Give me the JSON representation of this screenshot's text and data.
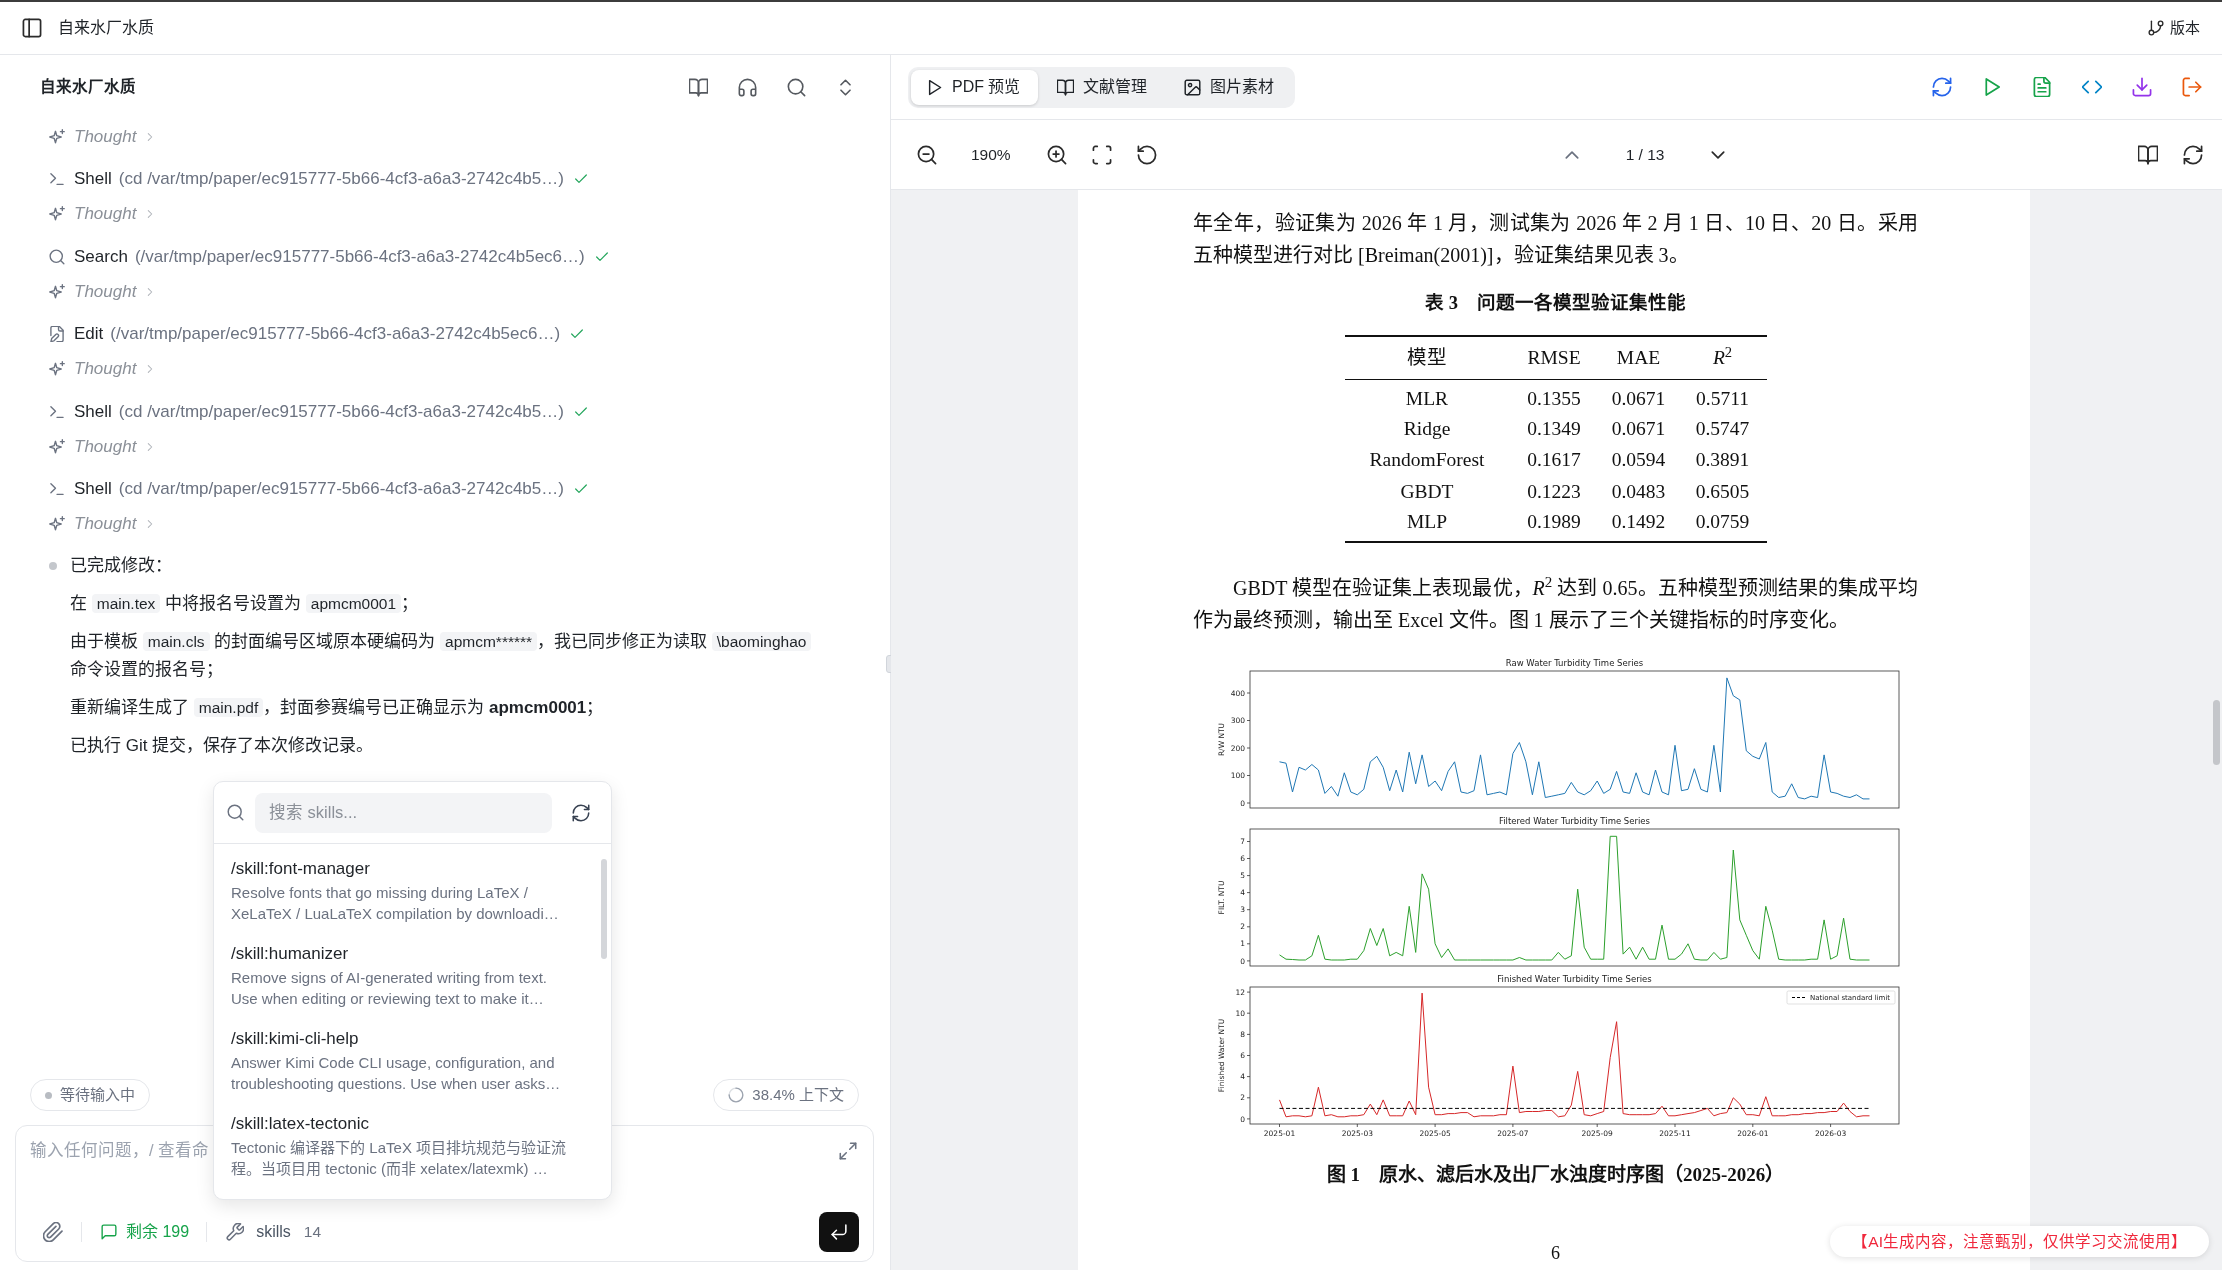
{
  "top_bar": {
    "title": "自来水厂水质",
    "version_label": "版本"
  },
  "chat": {
    "title": "自来水厂水质",
    "steps": [
      {
        "kind": "thought",
        "label": "Thought",
        "expanded": false
      },
      {
        "kind": "shell",
        "label": "Shell",
        "detail": "(cd /var/tmp/paper/ec915777-5b66-4cf3-a6a3-2742c4b5…)",
        "done": true
      },
      {
        "kind": "thought",
        "label": "Thought",
        "expanded": false
      },
      {
        "kind": "search",
        "label": "Search",
        "detail": "(/var/tmp/paper/ec915777-5b66-4cf3-a6a3-2742c4b5ec6…)",
        "done": true
      },
      {
        "kind": "thought",
        "label": "Thought",
        "expanded": false
      },
      {
        "kind": "edit",
        "label": "Edit",
        "detail": "(/var/tmp/paper/ec915777-5b66-4cf3-a6a3-2742c4b5ec6…)",
        "done": true
      },
      {
        "kind": "thought",
        "label": "Thought",
        "expanded": false
      },
      {
        "kind": "shell",
        "label": "Shell",
        "detail": "(cd /var/tmp/paper/ec915777-5b66-4cf3-a6a3-2742c4b5…)",
        "done": true
      },
      {
        "kind": "thought",
        "label": "Thought",
        "expanded": false
      },
      {
        "kind": "shell",
        "label": "Shell",
        "detail": "(cd /var/tmp/paper/ec915777-5b66-4cf3-a6a3-2742c4b5…)",
        "done": true
      },
      {
        "kind": "thought",
        "label": "Thought",
        "expanded": false
      }
    ],
    "summary": {
      "heading": "已完成修改：",
      "lines": [
        [
          {
            "kind": "text",
            "text": "在 "
          },
          {
            "kind": "code",
            "text": "main.tex"
          },
          {
            "kind": "text",
            "text": " 中将报名号设置为 "
          },
          {
            "kind": "code",
            "text": "apmcm0001"
          },
          {
            "kind": "text",
            "text": "；"
          }
        ],
        [
          {
            "kind": "text",
            "text": "由于模板 "
          },
          {
            "kind": "code",
            "text": "main.cls"
          },
          {
            "kind": "text",
            "text": " 的封面编号区域原本硬编码为 "
          },
          {
            "kind": "code",
            "text": "apmcm******"
          },
          {
            "kind": "text",
            "text": "，我已同步修正为读取 "
          },
          {
            "kind": "code",
            "text": "\\baominghao"
          },
          {
            "kind": "text",
            "text": " 命令设置的报名号；"
          }
        ],
        [
          {
            "kind": "text",
            "text": "重新编译生成了 "
          },
          {
            "kind": "code",
            "text": "main.pdf"
          },
          {
            "kind": "text",
            "text": "，封面参赛编号已正确显示为 **apmcm0001**；"
          }
        ],
        [
          {
            "kind": "text",
            "text": "已执行 Git 提交，保存了本次修改记录。"
          }
        ]
      ]
    },
    "status": "等待输入中",
    "context_usage": "38.4% 上下文",
    "composer": {
      "placeholder": "输入任何问题，/ 查看命",
      "remaining": "剩余 199",
      "skills_label": "skills",
      "skills_count": "14"
    },
    "skills_menu": {
      "search_placeholder": "搜索 skills...",
      "items": [
        {
          "name": "/skill:font-manager",
          "description": "Resolve fonts that go missing during LaTeX / XeLaTeX / LuaLaTeX compilation by downloadi…"
        },
        {
          "name": "/skill:humanizer",
          "description": "Remove signs of AI-generated writing from text. Use when editing or reviewing text to make it…"
        },
        {
          "name": "/skill:kimi-cli-help",
          "description": "Answer Kimi Code CLI usage, configuration, and troubleshooting questions. Use when user asks…"
        },
        {
          "name": "/skill:latex-tectonic",
          "description": "Tectonic 编译器下的 LaTeX 项目排坑规范与验证流程。当项目用 tectonic (而非 xelatex/latexmk) …"
        }
      ]
    }
  },
  "preview": {
    "tabs": [
      {
        "label": "PDF 预览",
        "selected": true
      },
      {
        "label": "文献管理",
        "selected": false
      },
      {
        "label": "图片素材",
        "selected": false
      }
    ],
    "zoom": "190%",
    "page_indicator": "1 / 13",
    "document": {
      "intro": "年全年，验证集为 2026 年 1 月，测试集为 2026 年 2 月 1 日、10 日、20 日。采用五种模型进行对比 [Breiman(2001)]，验证集结果见表 3。",
      "table": {
        "caption": "表 3　问题一各模型验证集性能",
        "columns": [
          "模型",
          "RMSE",
          "MAE",
          "*R*$^{2}$"
        ],
        "rows": [
          [
            "MLR",
            "0.1355",
            "0.0671",
            "0.5711"
          ],
          [
            "Ridge",
            "0.1349",
            "0.0671",
            "0.5747"
          ],
          [
            "RandomForest",
            "0.1617",
            "0.0594",
            "0.3891"
          ],
          [
            "GBDT",
            "0.1223",
            "0.0483",
            "0.6505"
          ],
          [
            "MLP",
            "0.1989",
            "0.1492",
            "0.0759"
          ]
        ]
      },
      "paragraph": "GBDT 模型在验证集上表现最优，*R*$^{2}$ 达到 0.65。五种模型预测结果的集成平均作为最终预测，输出至 Excel 文件。图 1 展示了三个关键指标的时序变化。",
      "figure": {
        "panels": [
          {
            "chart_data": {
              "type": "line",
              "title": "Raw Water Turbidity Time Series",
              "ylabel": "R/W NTU",
              "categories": [
                null,
                null,
                null,
                null,
                null,
                null,
                null,
                null,
                null,
                null,
                null,
                null,
                null,
                null,
                null,
                null,
                null,
                null,
                null,
                null,
                null,
                null,
                null,
                null,
                null,
                null,
                null,
                null,
                null,
                null,
                null,
                null,
                null,
                null,
                null,
                null,
                null,
                null,
                null,
                null,
                null,
                null,
                null,
                null,
                null,
                null,
                null,
                null,
                null,
                null,
                null,
                null,
                null,
                null,
                null,
                null,
                null,
                null,
                null,
                null,
                null,
                null,
                null,
                null,
                null,
                null,
                null,
                null,
                null,
                null,
                null,
                null,
                null,
                null,
                null,
                null,
                null,
                null,
                null,
                null,
                null,
                null,
                null,
                null,
                null,
                null,
                null,
                null,
                null,
                null,
                null,
                null
              ],
              "series": [
                {
                  "color": "#1f77b4",
                  "values": [
                    150,
                    145,
                    40,
                    130,
                    120,
                    140,
                    120,
                    35,
                    60,
                    25,
                    110,
                    40,
                    30,
                    50,
                    150,
                    170,
                    130,
                    45,
                    120,
                    40,
                    185,
                    70,
                    175,
                    60,
                    80,
                    45,
                    115,
                    150,
                    40,
                    35,
                    45,
                    175,
                    30,
                    35,
                    40,
                    30,
                    180,
                    220,
                    150,
                    30,
                    150,
                    20,
                    25,
                    30,
                    35,
                    75,
                    40,
                    30,
                    45,
                    80,
                    35,
                    50,
                    115,
                    40,
                    35,
                    110,
                    40,
                    30,
                    120,
                    40,
                    30,
                    210,
                    45,
                    50,
                    125,
                    50,
                    40,
                    210,
                    40,
                    455,
                    390,
                    375,
                    190,
                    170,
                    160,
                    220,
                    40,
                    20,
                    25,
                    70,
                    20,
                    15,
                    25,
                    20,
                    175,
                    40,
                    35,
                    25,
                    20,
                    30,
                    15,
                    15
                  ]
                }
              ],
              "ylim": [
                -18,
                480
              ],
              "yticks": [
                0,
                100,
                200,
                300,
                400
              ]
            }
          },
          {
            "chart_data": {
              "type": "line",
              "title": "Filtered Water Turbidity Time Series",
              "ylabel": "FILT. NTU",
              "categories": [
                null,
                null,
                null,
                null,
                null,
                null,
                null,
                null,
                null,
                null,
                null,
                null,
                null,
                null,
                null,
                null,
                null,
                null,
                null,
                null,
                null,
                null,
                null,
                null,
                null,
                null,
                null,
                null,
                null,
                null,
                null,
                null,
                null,
                null,
                null,
                null,
                null,
                null,
                null,
                null,
                null,
                null,
                null,
                null,
                null,
                null,
                null,
                null,
                null,
                null,
                null,
                null,
                null,
                null,
                null,
                null,
                null,
                null,
                null,
                null,
                null,
                null,
                null,
                null,
                null,
                null,
                null,
                null,
                null,
                null,
                null,
                null,
                null,
                null,
                null,
                null,
                null,
                null,
                null,
                null,
                null,
                null,
                null,
                null,
                null,
                null,
                null,
                null,
                null,
                null,
                null,
                null
              ],
              "series": [
                {
                  "color": "#2ca02c",
                  "values": [
                    0.35,
                    0.1,
                    0.08,
                    0.05,
                    0.05,
                    0.3,
                    1.5,
                    0.1,
                    0.05,
                    0.05,
                    0.05,
                    0.1,
                    0.1,
                    0.6,
                    1.9,
                    0.9,
                    1.9,
                    0.3,
                    0.5,
                    0.3,
                    3.2,
                    0.5,
                    5.1,
                    4.2,
                    1.0,
                    0.2,
                    0.7,
                    0.05,
                    0.05,
                    0.05,
                    0.05,
                    0.05,
                    0.05,
                    0.05,
                    0.05,
                    0.05,
                    0.05,
                    0.2,
                    0.05,
                    0.05,
                    0.05,
                    0.05,
                    0.05,
                    0.5,
                    0.1,
                    0.3,
                    4.2,
                    0.8,
                    0.1,
                    0.1,
                    0.1,
                    7.3,
                    7.3,
                    0.4,
                    0.8,
                    0.1,
                    0.8,
                    0.1,
                    0.1,
                    2.1,
                    0.1,
                    0.1,
                    0.4,
                    1.0,
                    0.1,
                    0.05,
                    0.05,
                    0.5,
                    0.1,
                    0.2,
                    6.5,
                    2.4,
                    1.5,
                    0.6,
                    0.1,
                    3.2,
                    1.8,
                    0.1,
                    0.05,
                    0.05,
                    0.05,
                    0.05,
                    0.1,
                    0.1,
                    2.4,
                    0.1,
                    0.3,
                    2.5,
                    0.1,
                    0.05,
                    0.05,
                    0.05
                  ]
                }
              ],
              "ylim": [
                -0.3,
                7.73
              ],
              "yticks": [
                0,
                1,
                2,
                3,
                4,
                5,
                6,
                7
              ]
            }
          },
          {
            "chart_data": {
              "type": "line",
              "title": "Finished Water Turbidity Time Series",
              "ylabel": "Finished Water NTU",
              "categories": [
                "2025-01",
                null,
                null,
                null,
                null,
                null,
                null,
                null,
                null,
                null,
                null,
                null,
                "2025-03",
                null,
                null,
                null,
                null,
                null,
                null,
                null,
                null,
                null,
                null,
                null,
                "2025-05",
                null,
                null,
                null,
                null,
                null,
                null,
                null,
                null,
                null,
                null,
                null,
                "2025-07",
                null,
                null,
                null,
                null,
                null,
                null,
                null,
                null,
                null,
                null,
                null,
                null,
                "2025-09",
                null,
                null,
                null,
                null,
                null,
                null,
                null,
                null,
                null,
                null,
                null,
                "2025-11",
                null,
                null,
                null,
                null,
                null,
                null,
                null,
                null,
                null,
                null,
                null,
                "2026-01",
                null,
                null,
                null,
                null,
                null,
                null,
                null,
                null,
                null,
                null,
                null,
                "2026-03",
                null,
                null,
                null,
                null,
                null,
                null
              ],
              "series": [
                {
                  "color": "#d62728",
                  "values": [
                    1.8,
                    0.2,
                    0.3,
                    0.3,
                    0.2,
                    0.3,
                    3.0,
                    0.3,
                    0.4,
                    0.2,
                    0.2,
                    0.3,
                    0.3,
                    0.4,
                    1.4,
                    0.4,
                    1.8,
                    0.3,
                    0.3,
                    0.3,
                    1.7,
                    0.4,
                    11.9,
                    3.0,
                    0.4,
                    0.4,
                    0.5,
                    0.5,
                    0.6,
                    0.6,
                    0.2,
                    0.3,
                    0.3,
                    0.3,
                    0.4,
                    0.4,
                    5.0,
                    0.6,
                    0.7,
                    0.7,
                    0.7,
                    0.8,
                    0.8,
                    0.2,
                    0.3,
                    1.3,
                    4.5,
                    0.4,
                    0.3,
                    0.5,
                    0.7,
                    5.8,
                    9.2,
                    0.5,
                    0.4,
                    0.4,
                    0.4,
                    0.4,
                    0.5,
                    1.2,
                    0.3,
                    0.3,
                    0.4,
                    0.5,
                    0.6,
                    0.8,
                    1.0,
                    0.3,
                    0.5,
                    0.6,
                    2.0,
                    1.4,
                    0.4,
                    0.4,
                    0.3,
                    2.1,
                    0.3,
                    0.3,
                    0.3,
                    0.4,
                    0.4,
                    0.5,
                    0.5,
                    0.6,
                    0.6,
                    0.7,
                    0.7,
                    1.5,
                    0.7,
                    0.2,
                    0.3,
                    0.3
                  ]
                },
                {
                  "name": "National standard limit",
                  "color": "#000000",
                  "line_style": "dashed",
                  "values": [
                    1,
                    1,
                    1,
                    1,
                    1,
                    1,
                    1,
                    1,
                    1,
                    1,
                    1,
                    1,
                    1,
                    1,
                    1,
                    1,
                    1,
                    1,
                    1,
                    1,
                    1,
                    1,
                    1,
                    1,
                    1,
                    1,
                    1,
                    1,
                    1,
                    1,
                    1,
                    1,
                    1,
                    1,
                    1,
                    1,
                    1,
                    1,
                    1,
                    1,
                    1,
                    1,
                    1,
                    1,
                    1,
                    1,
                    1,
                    1,
                    1,
                    1,
                    1,
                    1,
                    1,
                    1,
                    1,
                    1,
                    1,
                    1,
                    1,
                    1,
                    1,
                    1,
                    1,
                    1,
                    1,
                    1,
                    1,
                    1,
                    1,
                    1,
                    1,
                    1,
                    1,
                    1,
                    1,
                    1,
                    1,
                    1,
                    1,
                    1,
                    1,
                    1,
                    1,
                    1,
                    1,
                    1,
                    1,
                    1,
                    1,
                    1,
                    1,
                    1
                  ]
                }
              ],
              "ylim": [
                -0.48,
                12.48
              ],
              "yticks": [
                0,
                2,
                4,
                6,
                8,
                10,
                12
              ]
            }
          }
        ],
        "caption": "图 1　原水、滤后水及出厂水浊度时序图（2025-2026）"
      },
      "page_number": "6"
    },
    "notice": "【AI生成内容，注意甄别，仅供学习交流使用】"
  }
}
